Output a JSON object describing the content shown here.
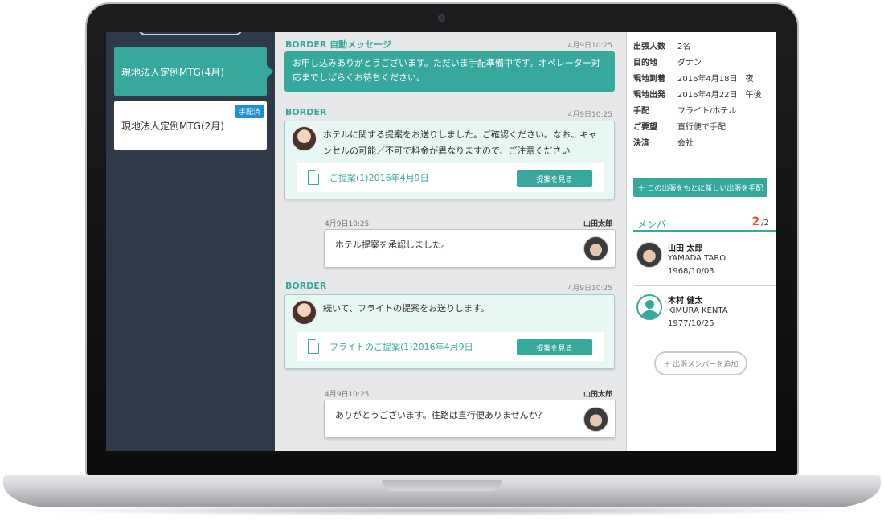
{
  "sidebar": {
    "items": [
      {
        "label": "現地法人定例MTG(4月)"
      },
      {
        "label": "現地法人定例MTG(2月)",
        "badge": "手配済"
      }
    ]
  },
  "chat": {
    "messages": [
      {
        "sender": "BORDER 自動メッセージ",
        "time": "4月9日10:25",
        "text": "お申し込みありがとうございます。ただいま手配準備中です。オペレーター対応までしばらくお待ちください。"
      },
      {
        "sender": "BORDER",
        "time": "4月9日10:25",
        "text": "ホテルに関する提案をお送りしました。ご確認ください。なお、キャンセルの可能／不可で料金が異なりますので、ご注意ください",
        "proposal_title": "ご提案(1)2016年4月9日",
        "button_label": "提案を見る"
      },
      {
        "user": "山田太郎",
        "time": "4月9日10:25",
        "text": "ホテル提案を承認しました。"
      },
      {
        "sender": "BORDER",
        "time": "4月9日10:25",
        "text": "続いて、フライトの提案をお送りします。",
        "proposal_title": "フライトのご提案(1)2016年4月9日",
        "button_label": "提案を見る"
      },
      {
        "user": "山田太郎",
        "time": "4月9日10:25",
        "text": "ありがとうございます。往路は直行便ありませんか？"
      }
    ]
  },
  "trip_info": {
    "rows": [
      {
        "label": "出張人数",
        "value": "2名"
      },
      {
        "label": "目的地",
        "value": "ダナン"
      },
      {
        "label": "現地到着",
        "value": "2016年4月18日　夜"
      },
      {
        "label": "現地出発",
        "value": "2016年4月22日　午後"
      },
      {
        "label": "手配",
        "value": "フライト/ホテル"
      },
      {
        "label": "ご要望",
        "value": "直行便で手配"
      },
      {
        "label": "決済",
        "value": "会社"
      }
    ],
    "new_trip_button": "＋ この出張をもとに新しい出張を手配"
  },
  "members": {
    "title": "メンバー",
    "count": "2",
    "total": "/2",
    "list": [
      {
        "name": "山田 太郎",
        "roman": "YAMADA TARO",
        "birth": "1968/10/03"
      },
      {
        "name": "木村 健太",
        "roman": "KIMURA KENTA",
        "birth": "1977/10/25"
      }
    ],
    "add_button": "＋ 出張メンバーを追加"
  },
  "colors": {
    "accent": "#37a99c",
    "sidebar": "#2f3a49",
    "badge": "#1e90d8",
    "count": "#e8522b"
  }
}
